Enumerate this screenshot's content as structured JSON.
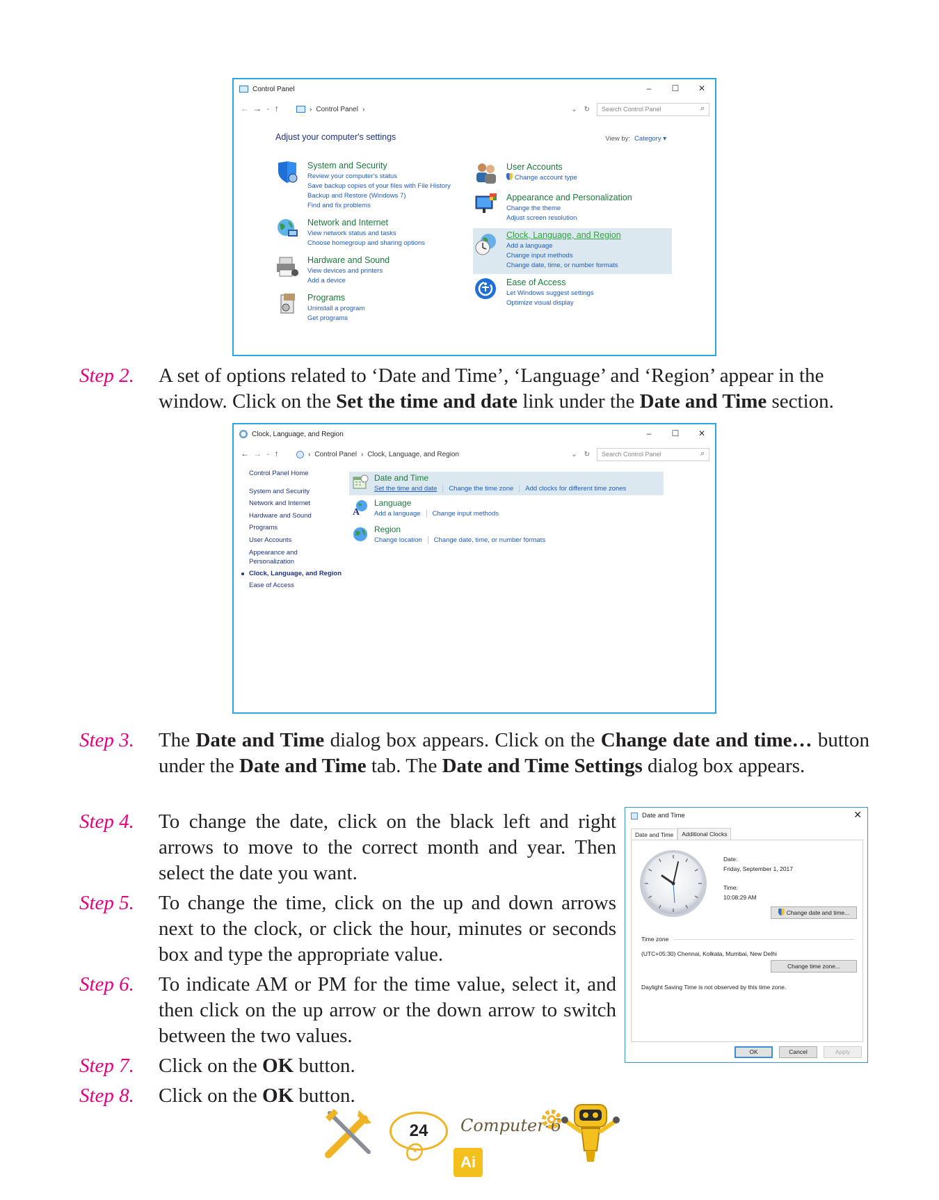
{
  "window1": {
    "title": "Control Panel",
    "controls": [
      "–",
      "☐",
      "✕"
    ],
    "breadcrumb": "Control Panel",
    "search_placeholder": "Search Control Panel",
    "heading": "Adjust your computer's settings",
    "view_by_label": "View by:",
    "view_by_value": "Category ▾",
    "categories_left": [
      {
        "title": "System and Security",
        "links": [
          "Review your computer's status",
          "Save backup copies of your files with File History",
          "Backup and Restore (Windows 7)",
          "Find and fix problems"
        ]
      },
      {
        "title": "Network and Internet",
        "links": [
          "View network status and tasks",
          "Choose homegroup and sharing options"
        ]
      },
      {
        "title": "Hardware and Sound",
        "links": [
          "View devices and printers",
          "Add a device"
        ]
      },
      {
        "title": "Programs",
        "links": [
          "Uninstall a program",
          "Get programs"
        ]
      }
    ],
    "categories_right": [
      {
        "title": "User Accounts",
        "links": [
          "Change account type"
        ]
      },
      {
        "title": "Appearance and Personalization",
        "links": [
          "Change the theme",
          "Adjust screen resolution"
        ]
      },
      {
        "title": "Clock, Language, and Region",
        "links": [
          "Add a language",
          "Change input methods",
          "Change date, time, or number formats"
        ]
      },
      {
        "title": "Ease of Access",
        "links": [
          "Let Windows suggest settings",
          "Optimize visual display"
        ]
      }
    ]
  },
  "steps": [
    {
      "label": "Step 2.",
      "lines": [
        "A set of options related to ‘Date and Time’, ‘Language’ and ‘Region’ appear in the"
      ],
      "line2_pre": "window. Click on the ",
      "line2_b1": "Set the time and date",
      "line2_mid": " link under the ",
      "line2_b2": "Date and Time",
      "line2_post": " section."
    },
    {
      "label": "Step 3.",
      "p1": "The ",
      "b1": "Date and Time",
      "p2": " dialog box appears. Click on the ",
      "b2": "Change date and time…",
      "p3": " button under the ",
      "b3": "Date and Time",
      "p4": " tab. The ",
      "b4": "Date and Time Settings",
      "p5": " dialog box appears."
    },
    {
      "label": "Step 4.",
      "text": "To change the date, click on the black left and right arrows to move to the correct month and year. Then select the date you want."
    },
    {
      "label": "Step 5.",
      "text": "To change the time, click on the up and down arrows next to the clock, or click the hour, minutes or seconds box and type the appropriate value."
    },
    {
      "label": "Step 6.",
      "text": "To indicate AM or PM for the time value, select it, and then click on the up arrow or the down arrow to switch between the two values."
    },
    {
      "label": "Step 7.",
      "pre": "Click on the ",
      "b": "OK",
      "post": " button."
    },
    {
      "label": "Step 8.",
      "pre": "Click on the ",
      "b": "OK",
      "post": " button."
    }
  ],
  "window2": {
    "title": "Clock, Language, and Region",
    "controls": [
      "–",
      "☐",
      "✕"
    ],
    "breadcrumb": [
      "Control Panel",
      "Clock, Language, and Region"
    ],
    "search_placeholder": "Search Control Panel",
    "sidebar": [
      "Control Panel Home",
      "System and Security",
      "Network and Internet",
      "Hardware and Sound",
      "Programs",
      "User Accounts",
      "Appearance and Personalization",
      "Clock, Language, and Region",
      "Ease of Access"
    ],
    "groups": [
      {
        "title": "Date and Time",
        "links": [
          "Set the time and date",
          "Change the time zone",
          "Add clocks for different time zones"
        ]
      },
      {
        "title": "Language",
        "links": [
          "Add a language",
          "Change input methods"
        ]
      },
      {
        "title": "Region",
        "links": [
          "Change location",
          "Change date, time, or number formats"
        ]
      }
    ]
  },
  "dialog": {
    "title": "Date and Time",
    "close": "✕",
    "tabs": [
      "Date and Time",
      "Additional Clocks"
    ],
    "date_label": "Date:",
    "date_value": "Friday, September 1, 2017",
    "time_label": "Time:",
    "time_value": "10:08:29 AM",
    "change_datetime_button": "Change date and time...",
    "timezone_label": "Time zone",
    "timezone_value": "(UTC+05:30) Chennai, Kolkata, Mumbai, New Delhi",
    "change_timezone_button": "Change time zone...",
    "dst_note": "Daylight Saving Time is not observed by this time zone.",
    "buttons": [
      "OK",
      "Cancel",
      "Apply"
    ]
  },
  "footer": {
    "page_number": "24",
    "book_title": "Computer-6",
    "badge": "Ai"
  }
}
